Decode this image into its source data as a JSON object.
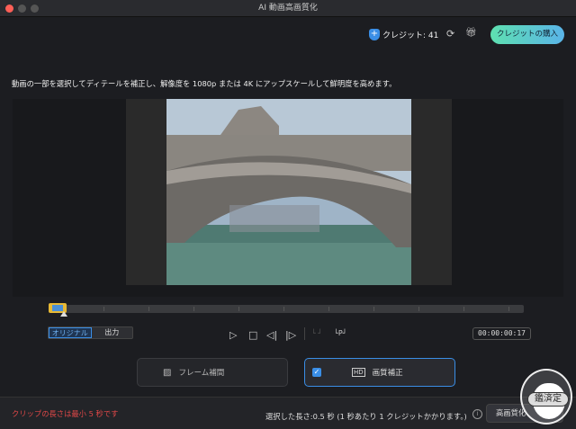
{
  "window": {
    "title": "AI 動画高画質化"
  },
  "header": {
    "credit_label": "クレジット: 41",
    "buy_button": "クレジットの購入"
  },
  "description": "動画の一部を選択してディテールを補正し、解像度を 1080p または 4K にアップスケールして鮮明度を高めます。",
  "view_toggle": {
    "original": "オリジナル",
    "output": "出力",
    "selected": "オリジナル"
  },
  "playback": {
    "timecode": "00:00:00:17"
  },
  "modes": [
    {
      "label": "フレーム補間",
      "checked": false
    },
    {
      "label": "画質補正",
      "checked": true
    }
  ],
  "footer": {
    "warning": "クリップの長さは最小 5 秒です",
    "selection_info": "選択した長さ:0.5 秒 (1 秒あたり 1 クレジットかかります。)",
    "enhance_button": "高画質化"
  },
  "watermark": {
    "text": "鑑定済"
  },
  "colors": {
    "accent": "#3a8ee6",
    "warning": "#e04848"
  }
}
